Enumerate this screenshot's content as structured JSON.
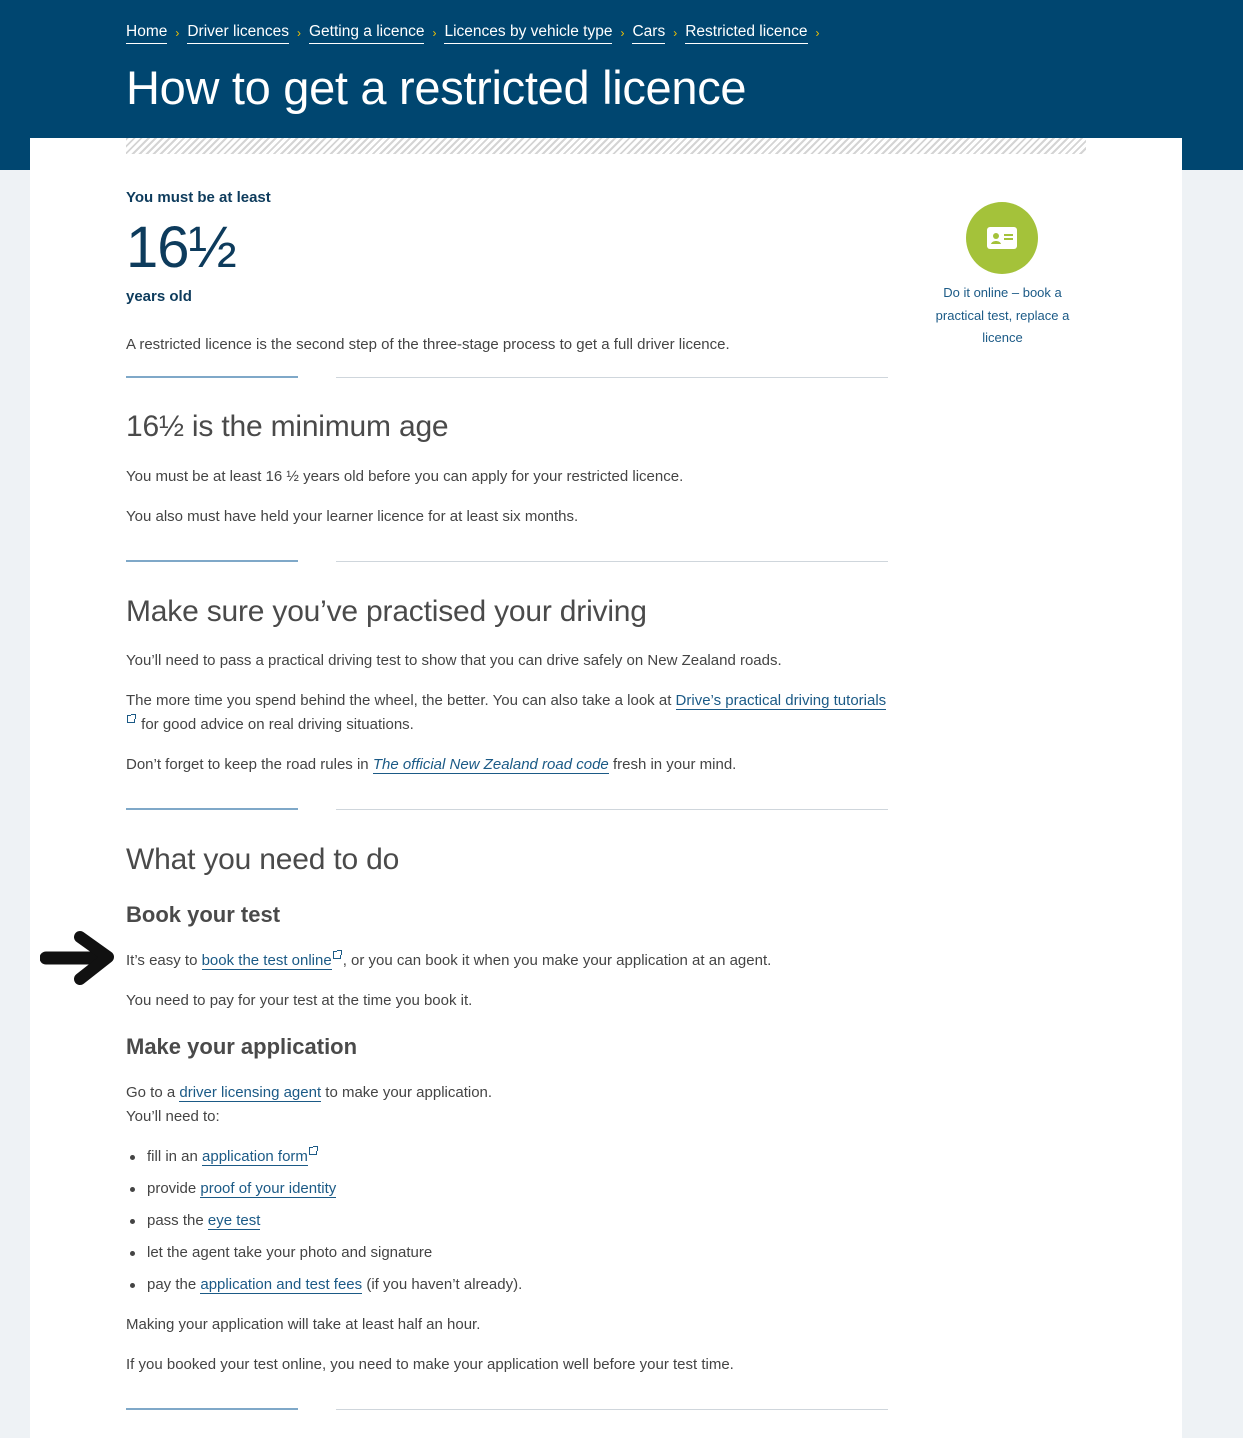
{
  "breadcrumb": {
    "items": [
      "Home",
      "Driver licences",
      "Getting a licence",
      "Licences by vehicle type",
      "Cars",
      "Restricted licence"
    ],
    "separator": "›"
  },
  "page_title": "How to get a restricted licence",
  "intro": {
    "label": "You must be at least",
    "age": "16½",
    "unit": "years old",
    "text": "A restricted licence is the second step of the three-stage process to get a full driver licence."
  },
  "sidebar": {
    "icon": "licence-card-icon",
    "link_text": "Do it online – book a practical test, replace a licence",
    "accent_color": "#a4c23a"
  },
  "section_min_age": {
    "heading": "16½ is the minimum age",
    "p1": "You must be at least 16 ½ years old before you can apply for your restricted licence.",
    "p2": "You also must have held your learner licence for at least six months."
  },
  "section_practise": {
    "heading": "Make sure you’ve practised your driving",
    "p1": "You’ll need to pass a practical driving test to show that you can drive safely on New Zealand roads.",
    "p2_before": "The more time you spend behind the wheel, the better. You can also take a look at ",
    "p2_link": "Drive’s practical driving tutorials",
    "p2_after": " for good advice on real driving situations.",
    "p3_before": "Don’t forget to keep the road rules in ",
    "p3_link": "The official New Zealand road code",
    "p3_after": " fresh in your mind."
  },
  "section_todo": {
    "heading": "What you need to do",
    "book": {
      "heading": "Book your test",
      "p1_before": "It’s easy to ",
      "p1_link": "book the test online",
      "p1_after": ", or you can book it when you make your application at an agent.",
      "p2": "You need to pay for your test at the time you book it."
    },
    "apply": {
      "heading": "Make your application",
      "p1_before": "Go to a ",
      "p1_link": "driver licensing agent",
      "p1_after": " to make your application.",
      "p1_line2": "You’ll need to:",
      "list": [
        {
          "before": "fill in an ",
          "link": "application form",
          "after": "",
          "external": true
        },
        {
          "before": "provide ",
          "link": "proof of your identity",
          "after": "",
          "external": false
        },
        {
          "before": "pass the ",
          "link": "eye test",
          "after": "",
          "external": false
        },
        {
          "before": "let the agent take your photo and signature",
          "link": "",
          "after": "",
          "external": false
        },
        {
          "before": "pay the ",
          "link": "application and test fees",
          "after": " (if you haven’t already).",
          "external": false
        }
      ],
      "p2": "Making your application will take at least half an hour.",
      "p3": "If you booked your test online, you need to make your application well before your test time."
    }
  },
  "colors": {
    "header_bg": "#004670",
    "link": "#1b5a86",
    "breadcrumb_separator": "#f2c200"
  }
}
